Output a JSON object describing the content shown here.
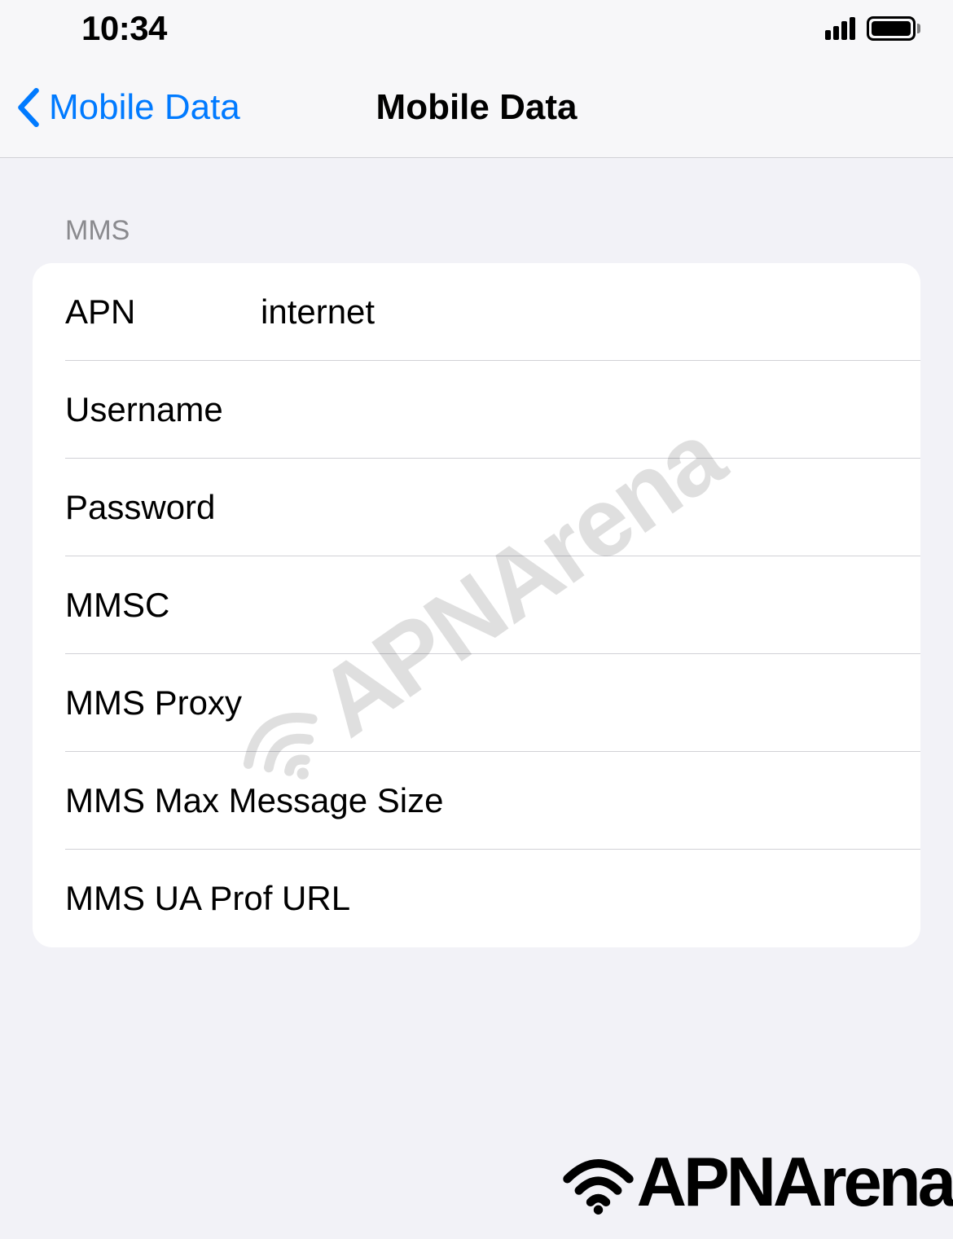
{
  "status_bar": {
    "time": "10:34"
  },
  "nav": {
    "back_label": "Mobile Data",
    "title": "Mobile Data"
  },
  "section": {
    "header": "MMS",
    "rows": [
      {
        "label": "APN",
        "value": "internet",
        "wide": false
      },
      {
        "label": "Username",
        "value": "",
        "wide": false
      },
      {
        "label": "Password",
        "value": "",
        "wide": false
      },
      {
        "label": "MMSC",
        "value": "",
        "wide": false
      },
      {
        "label": "MMS Proxy",
        "value": "",
        "wide": false
      },
      {
        "label": "MMS Max Message Size",
        "value": "",
        "wide": true
      },
      {
        "label": "MMS UA Prof URL",
        "value": "",
        "wide": true
      }
    ]
  },
  "watermark": "APNArena",
  "footer": "APNArena"
}
